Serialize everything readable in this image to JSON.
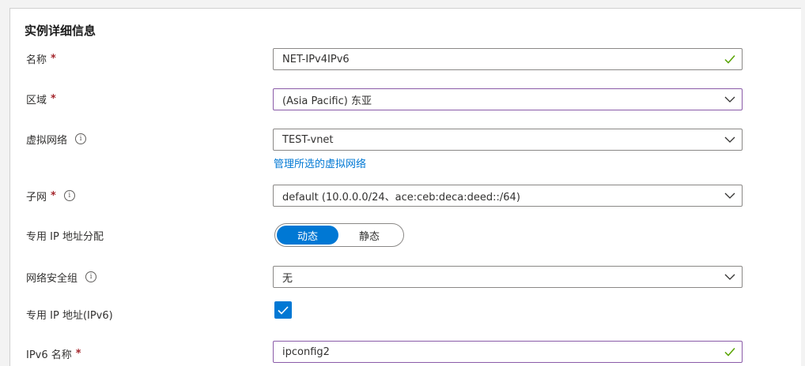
{
  "section_title": "实例详细信息",
  "required_mark": "*",
  "info_glyph": "i",
  "fields": {
    "name": {
      "label": "名称",
      "value": "NET-IPv4IPv6"
    },
    "region": {
      "label": "区域",
      "value": "(Asia Pacific) 东亚"
    },
    "vnet": {
      "label": "虚拟网络",
      "value": "TEST-vnet",
      "link": "管理所选的虚拟网络"
    },
    "subnet": {
      "label": "子网",
      "value": "default (10.0.0.0/24、ace:ceb:deca:deed::/64)"
    },
    "ip_assignment": {
      "label": "专用 IP 地址分配",
      "options": [
        "动态",
        "静态"
      ],
      "selected": "动态"
    },
    "nsg": {
      "label": "网络安全组",
      "value": "无"
    },
    "private_ipv6": {
      "label": "专用 IP 地址(IPv6)",
      "checked": true
    },
    "ipv6_name": {
      "label": "IPv6 名称",
      "value": "ipconfig2"
    }
  },
  "colors": {
    "accent": "#0078d4",
    "required": "#a4262c",
    "valid_check": "#57a300",
    "focus_border": "#8a5ba8"
  }
}
